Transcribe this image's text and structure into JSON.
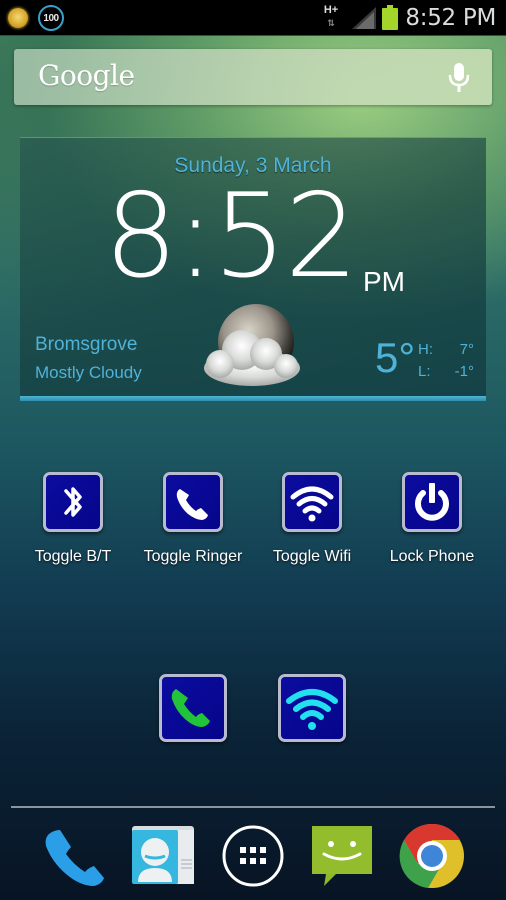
{
  "status_bar": {
    "notification_icons": [
      "weather-sun-icon",
      "battery-percent-icon"
    ],
    "battery_percent_badge": "100",
    "network_type": "H+",
    "network_arrows": "⇅",
    "time": "8:52 PM",
    "colors": {
      "battery": "#a4d52b",
      "battery_circle": "#3aa0c8"
    }
  },
  "search_bar": {
    "logo_text": "Google",
    "mic_icon": "microphone-icon"
  },
  "clock_widget": {
    "date": "Sunday, 3 March",
    "time_hours": "8",
    "time_separator": ":",
    "time_minutes": "52",
    "ampm": "PM",
    "location": "Bromsgrove",
    "condition": "Mostly Cloudy",
    "weather_icon": "moon-cloudy-icon",
    "current_temp": "5°",
    "high_label": "H:",
    "high_value": "7°",
    "low_label": "L:",
    "low_value": "-1°",
    "accent_color": "#4fb2d8"
  },
  "shortcuts": [
    {
      "label": "Toggle B/T",
      "icon": "bluetooth-icon"
    },
    {
      "label": "Toggle Ringer",
      "icon": "phone-ringer-icon"
    },
    {
      "label": "Toggle Wifi",
      "icon": "wifi-icon"
    },
    {
      "label": "Lock Phone",
      "icon": "power-icon"
    }
  ],
  "status_tiles": [
    {
      "icon": "phone-status-icon",
      "color": "#22c43a"
    },
    {
      "icon": "wifi-status-icon",
      "color": "#22e0f0"
    }
  ],
  "dock": [
    {
      "app": "Phone",
      "icon": "phone-app-icon"
    },
    {
      "app": "People",
      "icon": "contacts-app-icon"
    },
    {
      "app": "Apps",
      "icon": "app-drawer-icon"
    },
    {
      "app": "Messaging",
      "icon": "messaging-app-icon"
    },
    {
      "app": "Chrome",
      "icon": "chrome-app-icon"
    }
  ]
}
